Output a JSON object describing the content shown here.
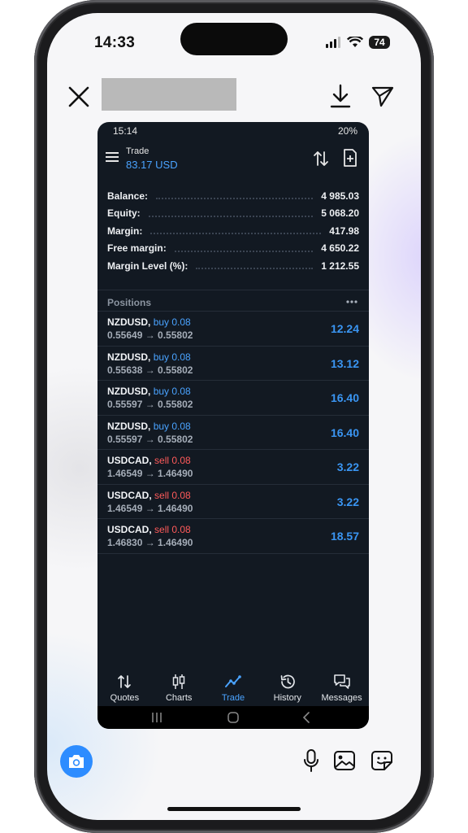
{
  "ios_status": {
    "time": "14:33",
    "battery": "74"
  },
  "viewer": {
    "actions": [
      "close-icon",
      "download-icon",
      "send-icon"
    ]
  },
  "screenshot": {
    "status_bar": {
      "time": "15:14",
      "battery": "20%"
    },
    "header": {
      "title": "Trade",
      "profit": "83.17 USD"
    },
    "account": [
      {
        "label": "Balance:",
        "value": "4 985.03"
      },
      {
        "label": "Equity:",
        "value": "5 068.20"
      },
      {
        "label": "Margin:",
        "value": "417.98"
      },
      {
        "label": "Free margin:",
        "value": "4 650.22"
      },
      {
        "label": "Margin Level (%):",
        "value": "1 212.55"
      }
    ],
    "positions_title": "Positions",
    "positions": [
      {
        "symbol": "NZDUSD,",
        "side": "buy 0.08",
        "prices": "0.55649 → 0.55802",
        "profit": "12.24"
      },
      {
        "symbol": "NZDUSD,",
        "side": "buy 0.08",
        "prices": "0.55638 → 0.55802",
        "profit": "13.12"
      },
      {
        "symbol": "NZDUSD,",
        "side": "buy 0.08",
        "prices": "0.55597 → 0.55802",
        "profit": "16.40"
      },
      {
        "symbol": "NZDUSD,",
        "side": "buy 0.08",
        "prices": "0.55597 → 0.55802",
        "profit": "16.40"
      },
      {
        "symbol": "USDCAD,",
        "side": "sell 0.08",
        "prices": "1.46549 → 1.46490",
        "profit": "3.22"
      },
      {
        "symbol": "USDCAD,",
        "side": "sell 0.08",
        "prices": "1.46549 → 1.46490",
        "profit": "3.22"
      },
      {
        "symbol": "USDCAD,",
        "side": "sell 0.08",
        "prices": "1.46830 → 1.46490",
        "profit": "18.57"
      }
    ],
    "nav": [
      {
        "label": "Quotes",
        "icon": "quotes-icon"
      },
      {
        "label": "Charts",
        "icon": "charts-icon"
      },
      {
        "label": "Trade",
        "icon": "trade-icon",
        "active": true
      },
      {
        "label": "History",
        "icon": "history-icon"
      },
      {
        "label": "Messages",
        "icon": "messages-icon"
      }
    ]
  },
  "colors": {
    "accent": "#4aa3ff",
    "sell": "#ff5a5a",
    "background": "#121922",
    "camera": "#2d8cff"
  }
}
